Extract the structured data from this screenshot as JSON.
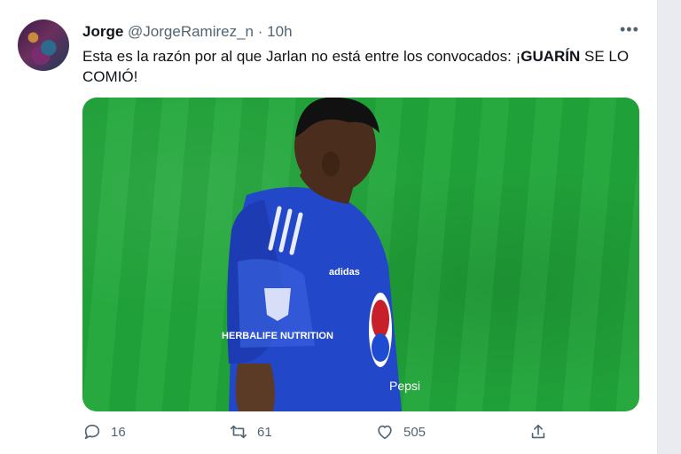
{
  "tweet": {
    "author_name": "Jorge",
    "handle": "@JorgeRamirez_n",
    "separator": "·",
    "time": "10h",
    "more_label": "•••",
    "text_pre": "Esta es la razón por al que Jarlan no está entre los convocados: ¡",
    "text_bold": "GUARÍN",
    "text_post": " SE LO COMIÓ!",
    "media": {
      "jersey_sponsor_1": "Pepsi",
      "jersey_sponsor_2": "HERBALIFE NUTRITION",
      "jersey_brand": "adidas"
    },
    "stats": {
      "replies": "16",
      "retweets": "61",
      "likes": "505"
    }
  },
  "colors": {
    "pitch": "#21a63a",
    "jersey": "#2347c9",
    "muted_text": "#536471"
  }
}
